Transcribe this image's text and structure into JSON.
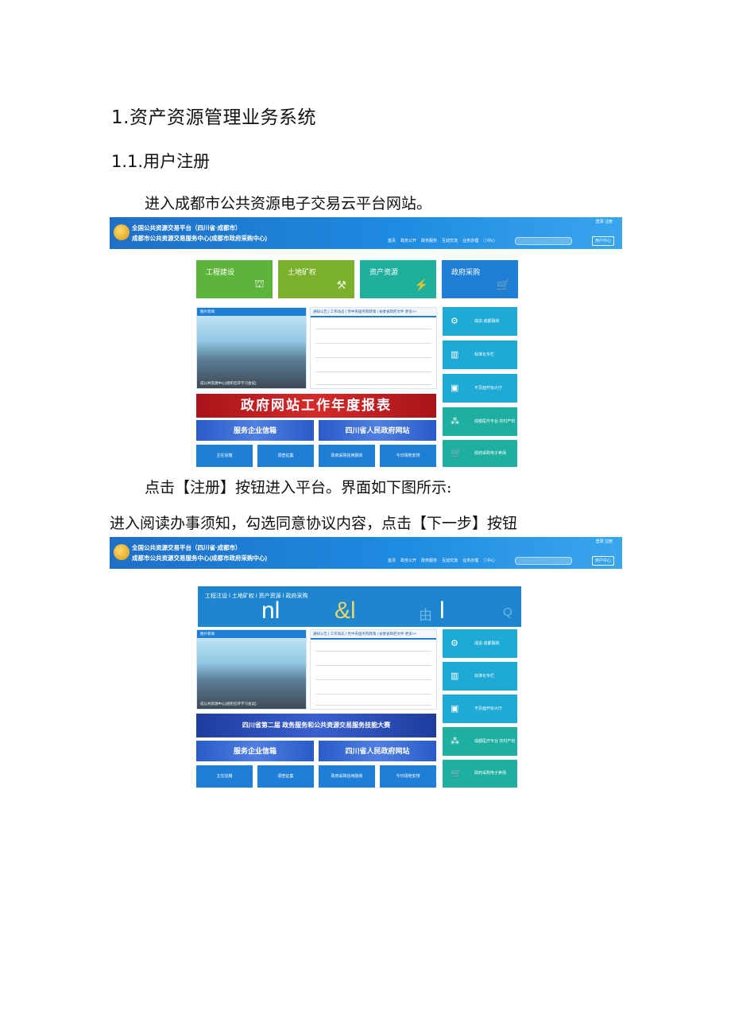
{
  "heading1": "1.资产资源管理业务系统",
  "heading2": "1.1.用户注册",
  "para1": "进入成都市公共资源电子交易云平台网站。",
  "para2": "点击【注册】按钮进入平台。界面如下图所示:",
  "para3": "进入阅读办事须知，勾选同意协议内容，点击【下一步】按钮",
  "site": {
    "title_line1": "全国公共资源交易平台（四川省·成都市）",
    "title_line2": "成都市公共资源交易服务中心(成都市政府采购中心)",
    "top_links": "登录  注册",
    "nav": [
      "首页",
      "政务公开",
      "政务服务",
      "互动交流",
      "业务办理",
      "ⓘ中心"
    ],
    "user_center": "用户中心"
  },
  "shot1": {
    "tiles": [
      {
        "label": "工程建设",
        "color": "#5db43a"
      },
      {
        "label": "土地矿权",
        "color": "#7ab02a"
      },
      {
        "label": "资产资源",
        "color": "#1faf9c"
      },
      {
        "label": "政府采购",
        "color": "#1f7fd6"
      }
    ],
    "news_head": "图片新闻",
    "news_more": "更多>>",
    "news_caption": "成公共资源中心(组织召开学习会议)",
    "list_tabs": "通知公告 | 工作动态 | 党中央国务院政策 | 省委省政府文件   更多>>",
    "red_banner": "政府网站工作年度报表",
    "blue_banner1": "服务企业信箱",
    "blue_banner2": "四川省人民政府网站",
    "bottom_buttons": [
      "主任信箱",
      "调查征集",
      "政府采购信用融资",
      "今日场地安排"
    ],
    "side": [
      {
        "label": "成渝·成都融资",
        "color": "#1faad6"
      },
      {
        "label": "标准化专栏",
        "color": "#1faad6"
      },
      {
        "label": "不见面开标大厅",
        "color": "#1faad6"
      },
      {
        "label": "成都医疗平台 农村产权交易",
        "color": "#1fafa0"
      },
      {
        "label": "政府采购电子卖场",
        "color": "#1fafa0"
      }
    ]
  },
  "shot2": {
    "tab_links": "工程注设 I 土地矿权 I 资产资源 I 政府采购",
    "glyph_a": "nl",
    "glyph_b": "&l",
    "glyph_c": "由",
    "glyph_d": "l",
    "glyph_e": "Q",
    "banner": "四川省第二届 政务服务和公共资源交易服务技能大赛"
  }
}
